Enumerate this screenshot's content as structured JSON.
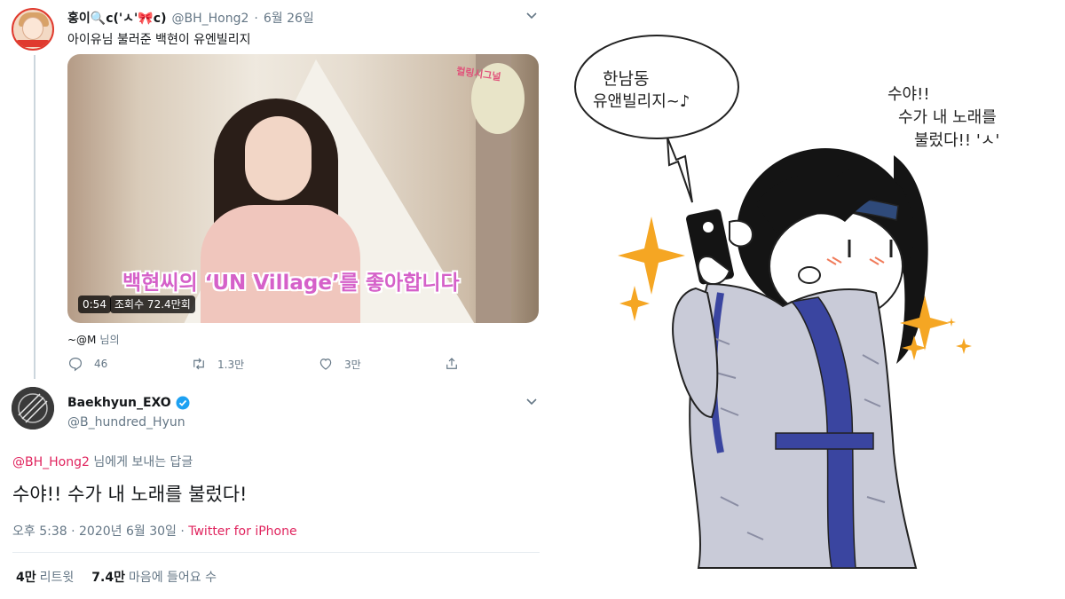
{
  "quoted_tweet": {
    "display_name": "홍이🔍c('ㅅ'🎀c)",
    "handle": "@BH_Hong2",
    "date": "6월 26일",
    "text": "아이유님 불러준 백현이 유엔빌리지",
    "video": {
      "subtitle": "백현씨의 ‘UN Village’를 좋아합니다",
      "corner_caption": "컬링시그널",
      "duration": "0:54",
      "views": "조회수 72.4만회"
    },
    "attribution": "~@M",
    "attribution_suffix": "님의",
    "actions": {
      "reply_count": "46",
      "retweet_count": "1.3만",
      "like_count": "3만"
    }
  },
  "reply_tweet": {
    "display_name": "Baekhyun_EXO",
    "handle": "@B_hundred_Hyun",
    "reply_to_mention": "@BH_Hong2",
    "reply_to_suffix": "님에게 보내는 답글",
    "text": "수야!! 수가 내 노래를 불렀다!",
    "timestamp": "오후 5:38 · 2020년 6월 30일 · ",
    "source": "Twitter for iPhone",
    "stats": {
      "retweets_value": "4만",
      "retweets_label": "리트윗",
      "likes_value": "7.4만",
      "likes_label": "마음에 들어요 수"
    },
    "verified": true
  },
  "illustration": {
    "speech_bubble_line1": "한남동",
    "speech_bubble_line2": "유앤빌리지~♪",
    "thought_line1": "수야!!",
    "thought_line2": "수가 내 노래를",
    "thought_line3": "불렀다!! 'ㅅ'"
  },
  "icons": {
    "reply": "reply-icon",
    "retweet": "retweet-icon",
    "like": "heart-icon",
    "share": "share-icon",
    "verified": "verified-badge-icon",
    "chevron": "chevron-down-icon"
  },
  "colors": {
    "link_pink": "#e0245e",
    "secondary_text": "#657786",
    "verified_blue": "#1da1f2",
    "sparkle_orange": "#f5a623",
    "robe_blue": "#3a45a0"
  }
}
